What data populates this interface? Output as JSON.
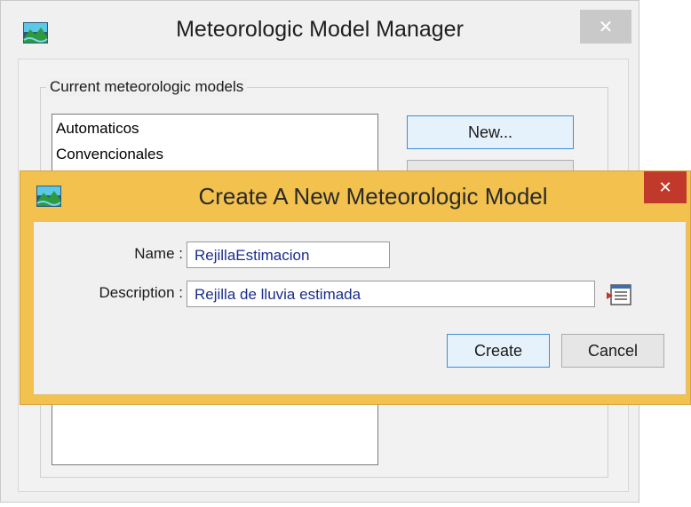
{
  "manager": {
    "title": "Meteorologic Model Manager",
    "close_glyph": "✕",
    "group_label": "Current meteorologic models",
    "models": [
      "Automaticos",
      "Convencionales"
    ],
    "new_button": "New..."
  },
  "dialog": {
    "title": "Create A New Meteorologic Model",
    "close_glyph": "✕",
    "name_label": "Name :",
    "name_value": "RejillaEstimacion",
    "description_label": "Description :",
    "description_value": "Rejilla de lluvia estimada",
    "create_button": "Create",
    "cancel_button": "Cancel"
  },
  "icons": {
    "app": "landscape-icon",
    "description_editor": "document-edit-icon"
  },
  "colors": {
    "dialog_frame": "#f2c14e",
    "dialog_close": "#c0392b",
    "input_text": "#1a2e8a",
    "primary_button_border": "#3c8ed9"
  }
}
